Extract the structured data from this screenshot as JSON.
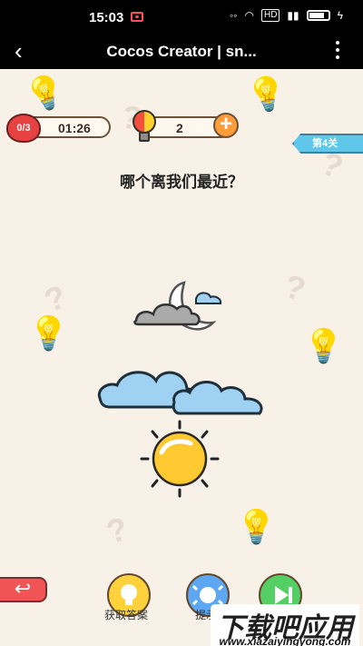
{
  "status": {
    "time": "15:03",
    "network": "HD"
  },
  "app": {
    "title": "Cocos Creator | sn..."
  },
  "game": {
    "lives": "0/3",
    "timer": "01:26",
    "hint_count": "2",
    "level": "第4关",
    "question": "哪个离我们最近？",
    "choices": [
      "moon",
      "clouds",
      "sun"
    ],
    "answer_label": "获取答案",
    "hint_label": "提示",
    "watermark": "下载吧应用",
    "watermark_sub": "www.xiazaiyingyong.com"
  }
}
